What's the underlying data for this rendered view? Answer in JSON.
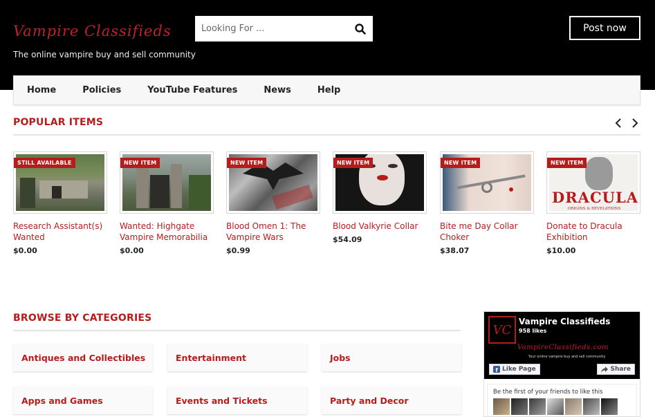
{
  "header": {
    "logo": "Vampire Classifieds",
    "tagline": "The online vampire buy and sell community",
    "search_placeholder": "Looking For ...",
    "post_label": "Post now"
  },
  "nav": [
    "Home",
    "Policies",
    "YouTube Features",
    "News",
    "Help"
  ],
  "popular": {
    "title": "POPULAR ITEMS",
    "items": [
      {
        "badge": "STILL AVAILABLE",
        "title": "Research Assistant(s) Wanted",
        "price": "$0.00"
      },
      {
        "badge": "NEW ITEM",
        "title": "Wanted: Highgate Vampire Memorabilia",
        "price": "$0.00"
      },
      {
        "badge": "NEW ITEM",
        "title": "Blood Omen 1: The Vampire Wars",
        "price": "$0.99"
      },
      {
        "badge": "NEW ITEM",
        "title": "Blood Valkyrie Collar",
        "price": "$54.09"
      },
      {
        "badge": "NEW ITEM",
        "title": "Bite me Day Collar Choker",
        "price": "$38.07"
      },
      {
        "badge": "NEW ITEM",
        "title": "Donate to Dracula Exhibition",
        "price": "$10.00"
      }
    ],
    "dracula_text": "DRACULA",
    "dracula_sub": "ORIGINS & REVELATIONS"
  },
  "categories": {
    "title": "BROWSE BY CATEGORIES",
    "items": [
      "Antiques and Collectibles",
      "Entertainment",
      "Jobs",
      "Apps and Games",
      "Events and Tickets",
      "Party and Decor"
    ]
  },
  "facebook": {
    "logo": "VC",
    "name": "Vampire Classifieds",
    "likes": "958 likes",
    "url": "VampireClassifieds.com",
    "small_tagline": "Your online vampire buy and sell community",
    "like_label": "Like Page",
    "share_label": "Share",
    "friends_text": "Be the first of your friends to like this"
  },
  "colors": {
    "brand": "#b71c1c",
    "header_bg": "#000000"
  }
}
